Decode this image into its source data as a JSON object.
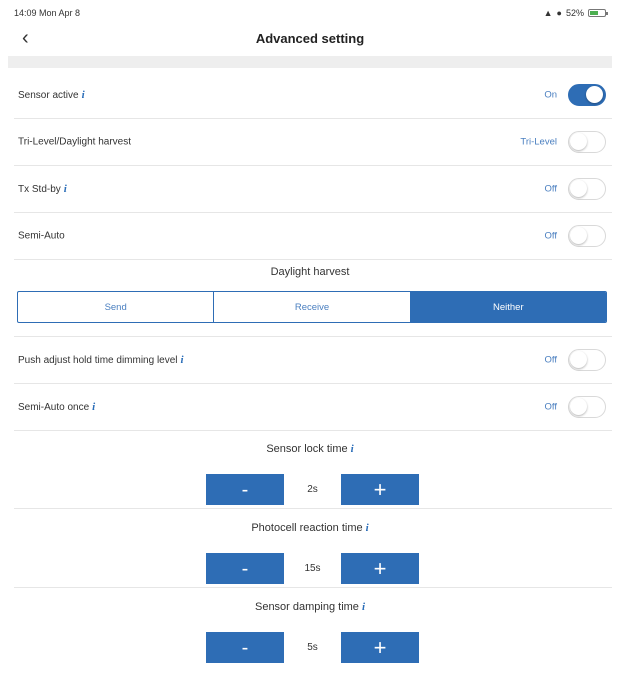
{
  "status_bar": {
    "time": "14:09  Mon Apr 8",
    "battery": "52%"
  },
  "nav": {
    "title": "Advanced setting"
  },
  "rows_top": [
    {
      "label": "Sensor active",
      "info": true,
      "value": "On",
      "on": true
    },
    {
      "label": "Tri-Level/Daylight harvest",
      "info": false,
      "value": "Tri-Level",
      "on": false
    },
    {
      "label": "Tx Std-by",
      "info": true,
      "value": "Off",
      "on": false
    },
    {
      "label": "Semi-Auto",
      "info": false,
      "value": "Off",
      "on": false
    }
  ],
  "daylight_harvest": {
    "title": "Daylight harvest",
    "options": [
      "Send",
      "Receive",
      "Neither"
    ],
    "selected": "Neither"
  },
  "rows_bottom": [
    {
      "label": "Push adjust hold time dimming level",
      "info": true,
      "value": "Off",
      "on": false
    },
    {
      "label": "Semi-Auto once",
      "info": true,
      "value": "Off",
      "on": false
    }
  ],
  "steppers": [
    {
      "title": "Sensor lock time",
      "value": "2s",
      "minus": "-",
      "plus": "+"
    },
    {
      "title": "Photocell reaction time",
      "value": "15s",
      "minus": "-",
      "plus": "+"
    },
    {
      "title": "Sensor damping time",
      "value": "5s",
      "minus": "-",
      "plus": "+"
    }
  ],
  "colors": {
    "accent": "#2e6db5",
    "divider_band": "#eeeeee"
  }
}
